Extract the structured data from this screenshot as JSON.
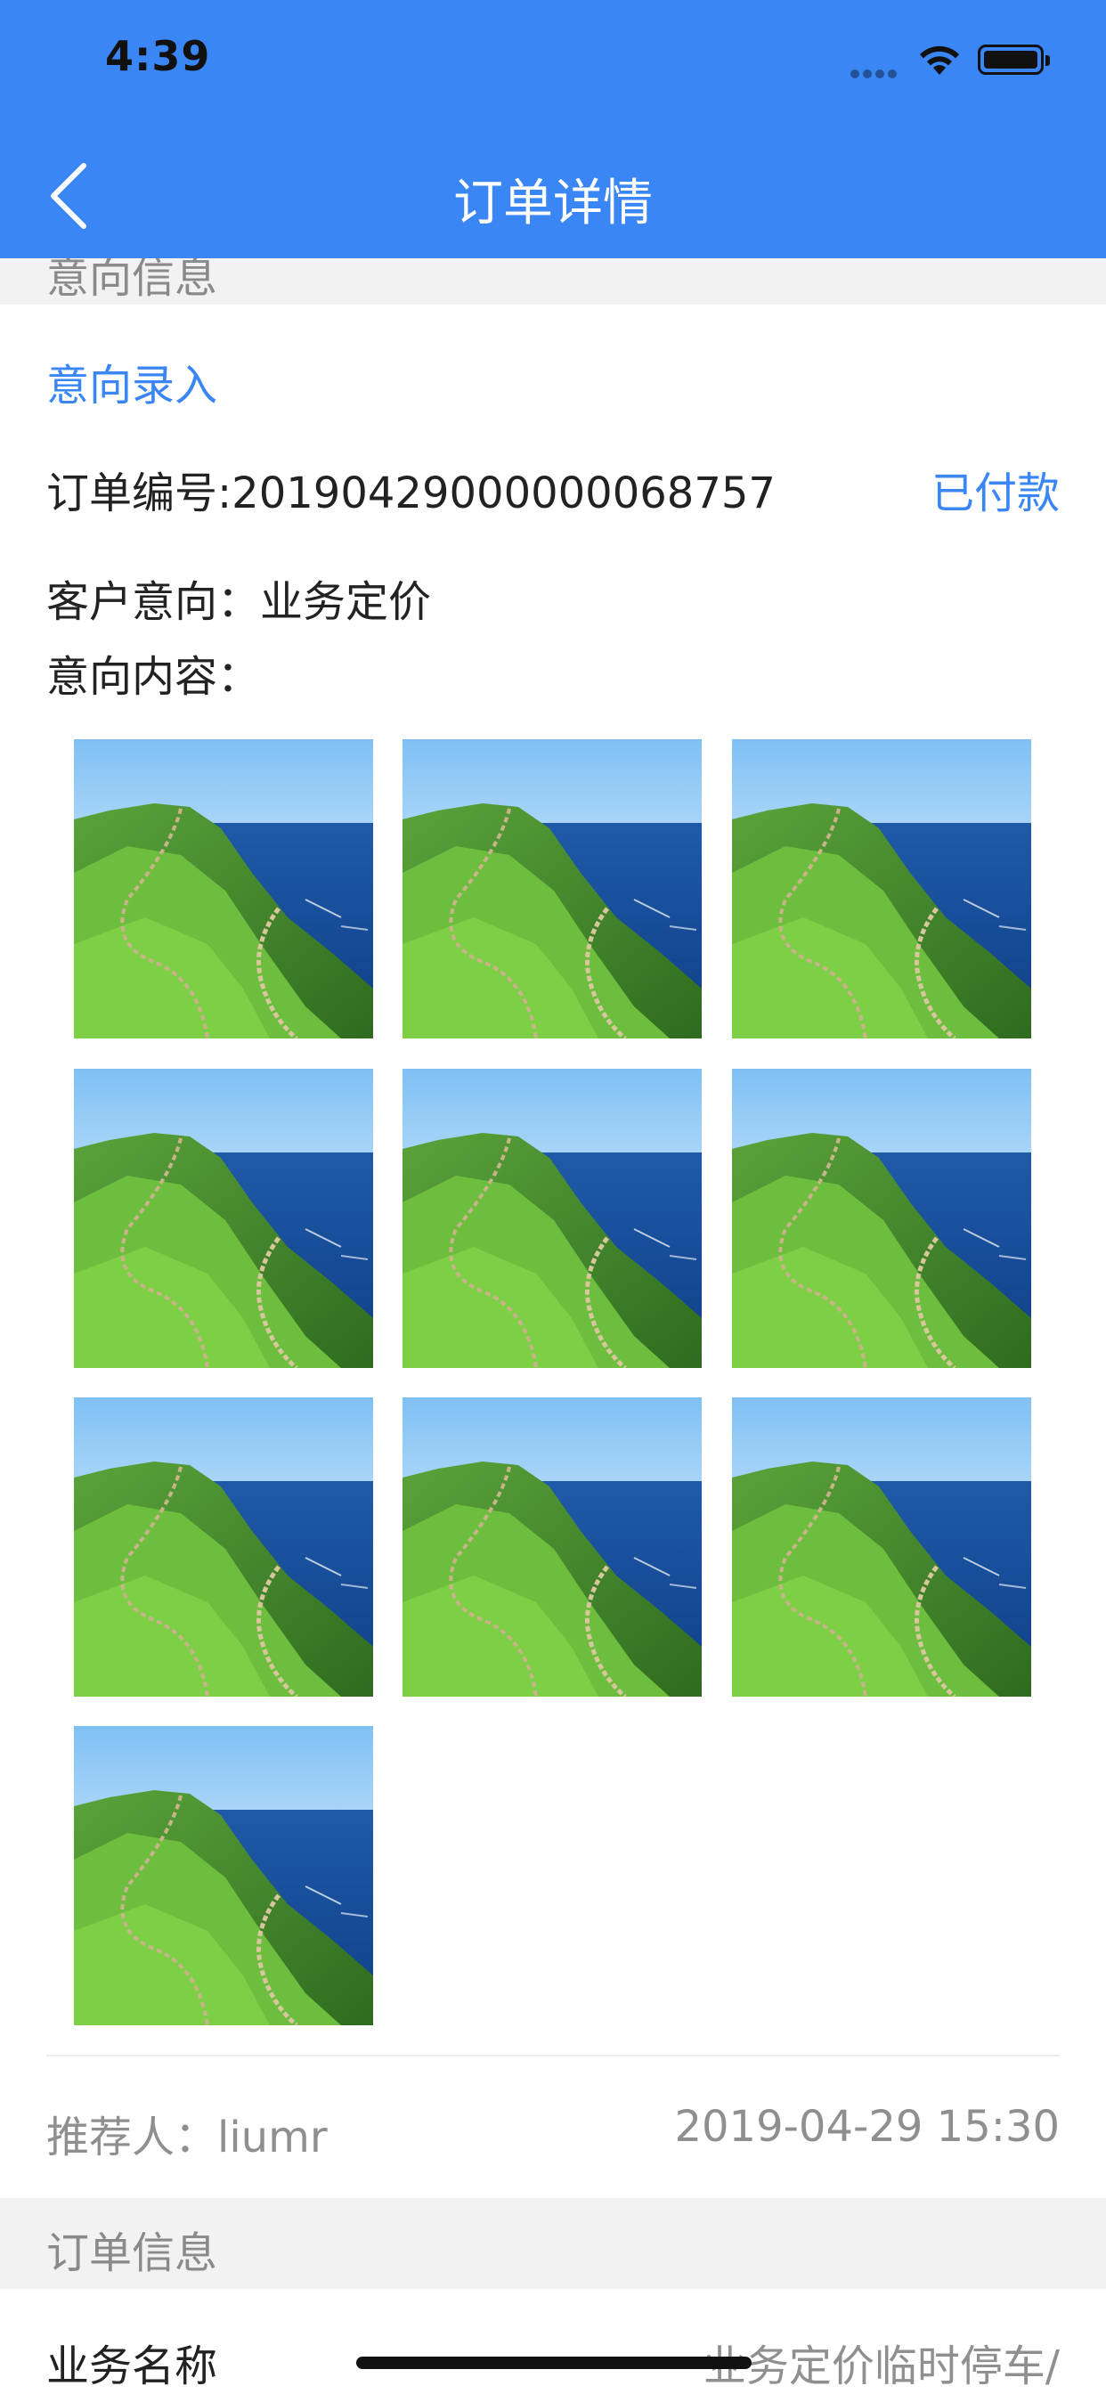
{
  "status_bar": {
    "time": "4:39"
  },
  "nav": {
    "title": "订单详情"
  },
  "intent_section": {
    "header": "意向信息",
    "entry_link": "意向录入",
    "order_number": "订单编号:20190429000000068757",
    "payment_status": "已付款",
    "customer_intent": "客户意向：业务定价",
    "intent_content_label": "意向内容：",
    "photo_count": 10,
    "referrer": "推荐人：liumr",
    "datetime": "2019-04-29 15:30"
  },
  "order_section": {
    "header": "订单信息",
    "business_name_label": "业务名称",
    "business_name_value": "业务定价临时停车/"
  },
  "colors": {
    "accent": "#3a86f5",
    "band": "#f2f2f2"
  }
}
